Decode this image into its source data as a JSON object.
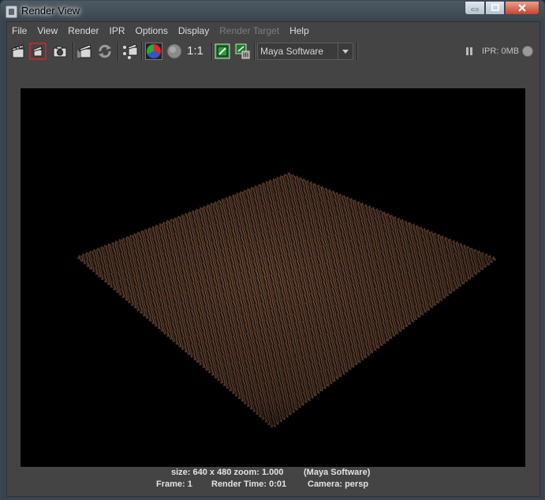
{
  "window": {
    "title": "Render View"
  },
  "menubar": {
    "items": [
      "File",
      "View",
      "Render",
      "IPR",
      "Options",
      "Display",
      "Render Target",
      "Help"
    ]
  },
  "toolbar": {
    "icons": [
      "clapboard-icon",
      "redo-render-icon",
      "snapshot-camera-icon",
      "ipr-render-icon",
      "refresh-ipr-icon",
      "render-region-icon",
      "rgb-channels-icon",
      "alpha-channel-icon",
      "real-size-icon",
      "keep-image-icon",
      "remove-image-icon"
    ],
    "real_size_label": "1:1",
    "renderer": "Maya Software",
    "ipr_status": "IPR: 0MB"
  },
  "status": {
    "size": "size: 640 x 480 zoom: 1.000",
    "renderer": "(Maya Software)",
    "frame": "Frame: 1",
    "render_time": "Render Time: 0:01",
    "camera": "Camera: persp"
  },
  "colors": {
    "fur": "#7a5540",
    "background": "#000000",
    "panel": "#444444"
  }
}
